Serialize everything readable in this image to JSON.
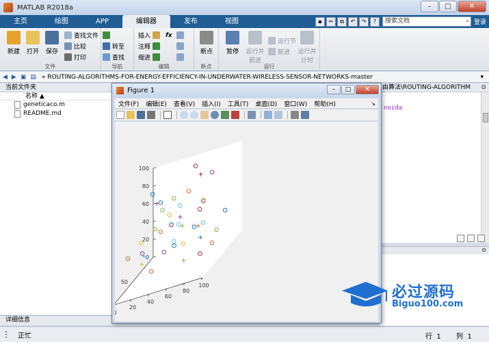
{
  "window": {
    "title": "MATLAB R2018a",
    "min": "–",
    "max": "□",
    "close": "✕"
  },
  "tabs": [
    "主页",
    "绘图",
    "APP",
    "编辑器",
    "发布",
    "视图"
  ],
  "search": {
    "placeholder": "搜索文档",
    "login": "登录"
  },
  "ribbon": {
    "file": {
      "label": "文件",
      "new": "新建",
      "open": "打开",
      "save": "保存",
      "find_file": "查找文件",
      "compare": "比较",
      "print": "打印"
    },
    "nav": {
      "label": "导航",
      "goto": "转至",
      "find": "查找"
    },
    "edit": {
      "label": "编辑",
      "insert": "插入",
      "comment": "注释",
      "indent": "缩进",
      "fx": "fx"
    },
    "breakpoint": {
      "label": "断点",
      "breakpoints": "断点"
    },
    "run": {
      "label": "运行",
      "pause": "暂停",
      "run_advance": "运行并前进",
      "run_section": "运行节",
      "advance": "前进",
      "run_time": "运行并计时"
    }
  },
  "address": {
    "path": "«  ROUTING-ALGORITHMS-FOR-ENERGY-EFFICIENCY-IN-UNDERWATER-WIRELESS-SENSOR-NETWORKS-master"
  },
  "left_panel": {
    "title": "当前文件夹",
    "col_name": "名称 ▲",
    "files": [
      "geneticaco.m",
      "README.md"
    ],
    "details": "详细信息"
  },
  "editor": {
    "header": "由算法\\ROUTING-ALGORITHM",
    "code_fragment": "noida"
  },
  "status": {
    "text": "正忙",
    "row_label": "行",
    "row": "1",
    "col_label": "列",
    "col": "1"
  },
  "figure": {
    "title": "Figure 1",
    "menus": [
      "文件(F)",
      "编辑(E)",
      "查看(V)",
      "插入(I)",
      "工具(T)",
      "桌面(D)",
      "窗口(W)",
      "帮助(H)"
    ]
  },
  "watermark": {
    "title": "必过源码",
    "subtitle": "Biguo100.com"
  },
  "chart_data": {
    "type": "scatter",
    "title": "",
    "xlabel": "",
    "ylabel": "",
    "zlabel": "",
    "z_ticks": [
      "0",
      "20",
      "40",
      "60",
      "80",
      "100"
    ],
    "y_ticks": [
      "0",
      "50"
    ],
    "x_ticks": [
      "0",
      "20",
      "40",
      "60",
      "80",
      "100"
    ],
    "zlim": [
      0,
      100
    ],
    "view": "3d",
    "markers": "circles and plus signs, multicolored",
    "series": [
      {
        "marker": "o",
        "points": [
          [
            12,
            8,
            62
          ],
          [
            18,
            22,
            35
          ],
          [
            25,
            15,
            48
          ],
          [
            30,
            40,
            18
          ],
          [
            35,
            55,
            72
          ],
          [
            42,
            30,
            40
          ],
          [
            48,
            62,
            55
          ],
          [
            55,
            20,
            28
          ],
          [
            60,
            45,
            80
          ],
          [
            65,
            70,
            33
          ],
          [
            72,
            35,
            60
          ],
          [
            78,
            15,
            15
          ],
          [
            82,
            58,
            45
          ],
          [
            88,
            80,
            70
          ],
          [
            92,
            25,
            38
          ],
          [
            95,
            65,
            22
          ],
          [
            20,
            75,
            50
          ],
          [
            10,
            50,
            28
          ],
          [
            40,
            85,
            65
          ],
          [
            70,
            90,
            85
          ],
          [
            50,
            5,
            90
          ],
          [
            15,
            35,
            85
          ],
          [
            28,
            68,
            12
          ],
          [
            62,
            12,
            52
          ],
          [
            85,
            42,
            92
          ],
          [
            33,
            22,
            68
          ],
          [
            58,
            78,
            42
          ],
          [
            75,
            50,
            8
          ],
          [
            45,
            48,
            25
          ],
          [
            8,
            82,
            40
          ]
        ]
      },
      {
        "marker": "+",
        "points": [
          [
            22,
            40,
            75
          ],
          [
            38,
            12,
            30
          ],
          [
            52,
            70,
            60
          ],
          [
            66,
            28,
            88
          ],
          [
            80,
            60,
            30
          ],
          [
            90,
            88,
            55
          ],
          [
            14,
            60,
            20
          ],
          [
            46,
            35,
            50
          ],
          [
            70,
            80,
            18
          ],
          [
            30,
            90,
            40
          ]
        ]
      }
    ]
  }
}
